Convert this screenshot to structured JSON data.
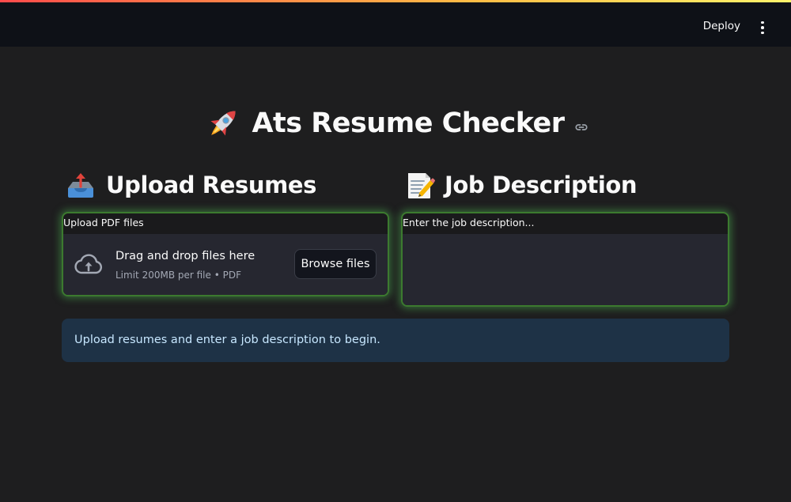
{
  "header": {
    "deploy_label": "Deploy",
    "menu_icon": "vertical-dots-icon"
  },
  "page": {
    "title": "Ats Resume Checker",
    "title_icon": "rocket-icon",
    "link_icon": "link-icon"
  },
  "upload": {
    "heading": "Upload Resumes",
    "heading_icon": "outbox-tray-icon",
    "label": "Upload PDF files",
    "drop_title": "Drag and drop files here",
    "drop_subtitle": "Limit 200MB per file • PDF",
    "browse_label": "Browse files",
    "cloud_icon": "cloud-upload-icon"
  },
  "job": {
    "heading": "Job Description",
    "heading_icon": "memo-icon",
    "label": "Enter the job description...",
    "value": ""
  },
  "info": {
    "message": "Upload resumes and enter a job description to begin."
  },
  "colors": {
    "background": "#1e1e1f",
    "header": "#0e1117",
    "input_bg": "#262730",
    "glow_border": "#3c7a2f",
    "info_bg": "#1e3246",
    "info_text": "#c7e7ff"
  }
}
